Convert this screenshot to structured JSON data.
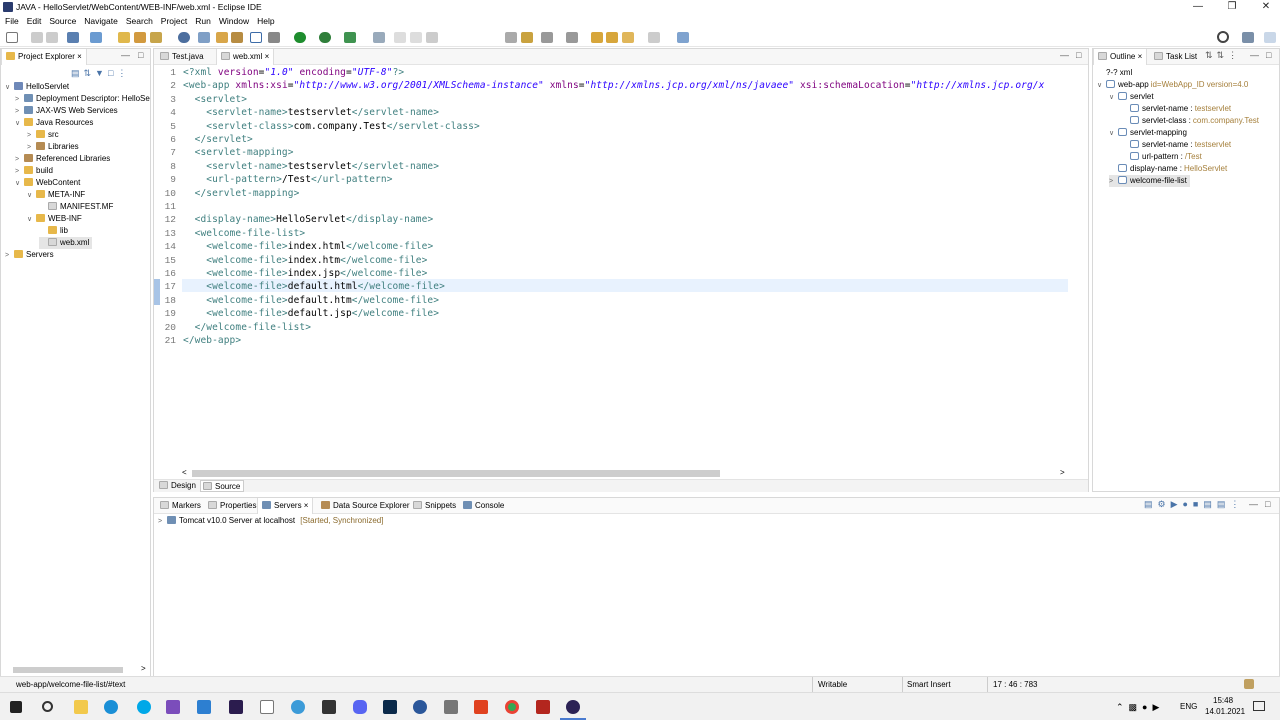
{
  "window": {
    "title": "JAVA - HelloServlet/WebContent/WEB-INF/web.xml - Eclipse IDE"
  },
  "menu": [
    "File",
    "Edit",
    "Source",
    "Navigate",
    "Search",
    "Project",
    "Run",
    "Window",
    "Help"
  ],
  "project_explorer": {
    "tab_label": "Project Explorer",
    "items": [
      {
        "label": "HelloServlet",
        "icon": "project-icon"
      },
      {
        "label": "Deployment Descriptor: HelloSe",
        "icon": "descriptor-icon"
      },
      {
        "label": "JAX-WS Web Services",
        "icon": "webservice-icon"
      },
      {
        "label": "Java Resources",
        "icon": "folder-icon"
      },
      {
        "label": "src",
        "icon": "package-folder-icon"
      },
      {
        "label": "Libraries",
        "icon": "library-icon"
      },
      {
        "label": "Referenced Libraries",
        "icon": "library-icon"
      },
      {
        "label": "build",
        "icon": "folder-icon"
      },
      {
        "label": "WebContent",
        "icon": "folder-icon"
      },
      {
        "label": "META-INF",
        "icon": "folder-icon"
      },
      {
        "label": "MANIFEST.MF",
        "icon": "file-icon"
      },
      {
        "label": "WEB-INF",
        "icon": "folder-icon"
      },
      {
        "label": "lib",
        "icon": "folder-icon"
      },
      {
        "label": "web.xml",
        "icon": "xml-file-icon"
      },
      {
        "label": "Servers",
        "icon": "folder-icon"
      }
    ]
  },
  "editor": {
    "tabs": [
      {
        "label": "Test.java"
      },
      {
        "label": "web.xml"
      }
    ],
    "bottom_tabs": [
      "Design",
      "Source"
    ],
    "line_numbers": [
      "1",
      "2",
      "3",
      "4",
      "5",
      "6",
      "7",
      "8",
      "9",
      "10",
      "11",
      "12",
      "13",
      "14",
      "15",
      "16",
      "17",
      "18",
      "19",
      "20",
      "21"
    ],
    "lines": [
      [
        [
          "pi",
          "<?xml "
        ],
        [
          "an",
          "version"
        ],
        [
          "tx",
          "="
        ],
        [
          "av",
          "\"1.0\""
        ],
        [
          "tx",
          " "
        ],
        [
          "an",
          "encoding"
        ],
        [
          "tx",
          "="
        ],
        [
          "av",
          "\"UTF-8\""
        ],
        [
          "pi",
          "?>"
        ]
      ],
      [
        [
          "tag",
          "<web-app "
        ],
        [
          "an",
          "xmlns:xsi"
        ],
        [
          "tx",
          "="
        ],
        [
          "av",
          "\"http://www.w3.org/2001/XMLSchema-instance\""
        ],
        [
          "tx",
          " "
        ],
        [
          "an",
          "xmlns"
        ],
        [
          "tx",
          "="
        ],
        [
          "av",
          "\"http://xmlns.jcp.org/xml/ns/javaee\""
        ],
        [
          "tx",
          " "
        ],
        [
          "an",
          "xsi:schemaLocation"
        ],
        [
          "tx",
          "="
        ],
        [
          "av",
          "\"http://xmlns.jcp.org/x"
        ]
      ],
      [
        [
          "tx",
          "  "
        ],
        [
          "tag",
          "<servlet>"
        ]
      ],
      [
        [
          "tx",
          "    "
        ],
        [
          "tag",
          "<servlet-name>"
        ],
        [
          "tx",
          "testservlet"
        ],
        [
          "tag",
          "</servlet-name>"
        ]
      ],
      [
        [
          "tx",
          "    "
        ],
        [
          "tag",
          "<servlet-class>"
        ],
        [
          "tx",
          "com.company.Test"
        ],
        [
          "tag",
          "</servlet-class>"
        ]
      ],
      [
        [
          "tx",
          "  "
        ],
        [
          "tag",
          "</servlet>"
        ]
      ],
      [
        [
          "tx",
          "  "
        ],
        [
          "tag",
          "<servlet-mapping>"
        ]
      ],
      [
        [
          "tx",
          "    "
        ],
        [
          "tag",
          "<servlet-name>"
        ],
        [
          "tx",
          "testservlet"
        ],
        [
          "tag",
          "</servlet-name>"
        ]
      ],
      [
        [
          "tx",
          "    "
        ],
        [
          "tag",
          "<url-pattern>"
        ],
        [
          "tx",
          "/Test"
        ],
        [
          "tag",
          "</url-pattern>"
        ]
      ],
      [
        [
          "tx",
          "  "
        ],
        [
          "tag",
          "</servlet-mapping>"
        ]
      ],
      [],
      [
        [
          "tx",
          "  "
        ],
        [
          "tag",
          "<display-name>"
        ],
        [
          "tx",
          "HelloServlet"
        ],
        [
          "tag",
          "</display-name>"
        ]
      ],
      [
        [
          "tx",
          "  "
        ],
        [
          "tag",
          "<welcome-file-list>"
        ]
      ],
      [
        [
          "tx",
          "    "
        ],
        [
          "tag",
          "<welcome-file>"
        ],
        [
          "tx",
          "index.html"
        ],
        [
          "tag",
          "</welcome-file>"
        ]
      ],
      [
        [
          "tx",
          "    "
        ],
        [
          "tag",
          "<welcome-file>"
        ],
        [
          "tx",
          "index.htm"
        ],
        [
          "tag",
          "</welcome-file>"
        ]
      ],
      [
        [
          "tx",
          "    "
        ],
        [
          "tag",
          "<welcome-file>"
        ],
        [
          "tx",
          "index.jsp"
        ],
        [
          "tag",
          "</welcome-file>"
        ]
      ],
      [
        [
          "tx",
          "    "
        ],
        [
          "tag",
          "<welcome-file>"
        ],
        [
          "tx",
          "default.html"
        ],
        [
          "tag",
          "</welcome-file>"
        ]
      ],
      [
        [
          "tx",
          "    "
        ],
        [
          "tag",
          "<welcome-file>"
        ],
        [
          "tx",
          "default.htm"
        ],
        [
          "tag",
          "</welcome-file>"
        ]
      ],
      [
        [
          "tx",
          "    "
        ],
        [
          "tag",
          "<welcome-file>"
        ],
        [
          "tx",
          "default.jsp"
        ],
        [
          "tag",
          "</welcome-file>"
        ]
      ],
      [
        [
          "tx",
          "  "
        ],
        [
          "tag",
          "</welcome-file-list>"
        ]
      ],
      [
        [
          "tag",
          "</web-app>"
        ]
      ]
    ]
  },
  "outline": {
    "tab_label": "Outline",
    "task_tab_label": "Task List",
    "items": [
      {
        "label": "?-? xml",
        "detail": ""
      },
      {
        "label": "web-app",
        "detail": "id=WebApp_ID version=4.0"
      },
      {
        "label": "servlet",
        "detail": ""
      },
      {
        "label": "servlet-name :",
        "detail": "testservlet"
      },
      {
        "label": "servlet-class :",
        "detail": "com.company.Test"
      },
      {
        "label": "servlet-mapping",
        "detail": ""
      },
      {
        "label": "servlet-name :",
        "detail": "testservlet"
      },
      {
        "label": "url-pattern :",
        "detail": "/Test"
      },
      {
        "label": "display-name :",
        "detail": "HelloServlet"
      },
      {
        "label": "welcome-file-list",
        "detail": ""
      }
    ]
  },
  "bottom_panel": {
    "tabs": [
      "Markers",
      "Properties",
      "Servers",
      "Data Source Explorer",
      "Snippets",
      "Console"
    ],
    "server": {
      "name": "Tomcat v10.0 Server at localhost",
      "status": "[Started, Synchronized]"
    }
  },
  "status_bar": {
    "path": "web-app/welcome-file-list/#text",
    "writable": "Writable",
    "insert_mode": "Smart Insert",
    "position": "17 : 46 : 783"
  },
  "taskbar": {
    "lang": "ENG",
    "time": "15:48",
    "date": "14.01.2021"
  }
}
